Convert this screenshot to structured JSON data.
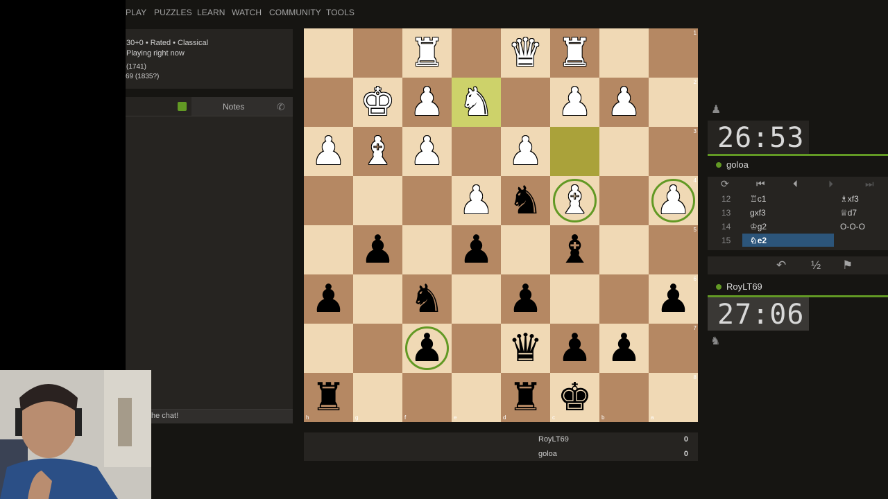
{
  "nav": {
    "items": [
      "PLAY",
      "PUZZLES",
      "LEARN",
      "WATCH",
      "COMMUNITY",
      "TOOLS"
    ]
  },
  "game_info": {
    "mode": "30+0 • Rated • Classical",
    "status": "Playing right now",
    "white_rating": "(1741)",
    "black_partial": "69 (1835?)"
  },
  "chat": {
    "tab_notes": "Notes",
    "input_placeholder": "he chat!"
  },
  "board": {
    "orientation": "black",
    "ranks_label": [
      "1",
      "2",
      "3",
      "4",
      "5",
      "6",
      "7",
      "8"
    ],
    "files_label": [
      "h",
      "g",
      "f",
      "e",
      "d",
      "c",
      "b",
      "a"
    ],
    "pieces": [
      {
        "sq": "f1",
        "p": "♜",
        "c": "w"
      },
      {
        "sq": "d1",
        "p": "♛",
        "c": "w"
      },
      {
        "sq": "c1",
        "p": "♜",
        "c": "w"
      },
      {
        "sq": "g2",
        "p": "♚",
        "c": "w"
      },
      {
        "sq": "f2",
        "p": "♟",
        "c": "w"
      },
      {
        "sq": "e2",
        "p": "♞",
        "c": "w"
      },
      {
        "sq": "c2",
        "p": "♟",
        "c": "w"
      },
      {
        "sq": "b2",
        "p": "♟",
        "c": "w"
      },
      {
        "sq": "h3",
        "p": "♟",
        "c": "w"
      },
      {
        "sq": "g3",
        "p": "♝",
        "c": "w"
      },
      {
        "sq": "f3",
        "p": "♟",
        "c": "w"
      },
      {
        "sq": "d3",
        "p": "♟",
        "c": "w"
      },
      {
        "sq": "e4",
        "p": "♟",
        "c": "w"
      },
      {
        "sq": "c4",
        "p": "♝",
        "c": "w"
      },
      {
        "sq": "a4",
        "p": "♟",
        "c": "w"
      },
      {
        "sq": "d4",
        "p": "♞",
        "c": "b"
      },
      {
        "sq": "g5",
        "p": "♟",
        "c": "b"
      },
      {
        "sq": "e5",
        "p": "♟",
        "c": "b"
      },
      {
        "sq": "c5",
        "p": "♝",
        "c": "b"
      },
      {
        "sq": "h6",
        "p": "♟",
        "c": "b"
      },
      {
        "sq": "f6",
        "p": "♞",
        "c": "b"
      },
      {
        "sq": "d6",
        "p": "♟",
        "c": "b"
      },
      {
        "sq": "a6",
        "p": "♟",
        "c": "b"
      },
      {
        "sq": "f7",
        "p": "♟",
        "c": "b"
      },
      {
        "sq": "d7",
        "p": "♛",
        "c": "b"
      },
      {
        "sq": "c7",
        "p": "♟",
        "c": "b"
      },
      {
        "sq": "b7",
        "p": "♟",
        "c": "b"
      },
      {
        "sq": "h8",
        "p": "♜",
        "c": "b"
      },
      {
        "sq": "d8",
        "p": "♜",
        "c": "b"
      },
      {
        "sq": "c8",
        "p": "♚",
        "c": "b"
      }
    ],
    "last_move": [
      "e2",
      "c3"
    ],
    "rings": [
      "c4",
      "a4",
      "f7"
    ]
  },
  "result_panel": {
    "rows": [
      {
        "name": "RoyLT69",
        "score": "0"
      },
      {
        "name": "goloa",
        "score": "0"
      }
    ]
  },
  "clocks": {
    "top": {
      "time": "26:53",
      "player": "goloa"
    },
    "bottom": {
      "time": "27:06",
      "player": "RoyLT69"
    }
  },
  "moves": [
    {
      "num": "12",
      "w": "♖c1",
      "b": "♗xf3"
    },
    {
      "num": "13",
      "w": "gxf3",
      "b": "♕d7"
    },
    {
      "num": "14",
      "w": "♔g2",
      "b": "O-O-O"
    },
    {
      "num": "15",
      "w": "♘e2",
      "b": ""
    }
  ],
  "actions": {
    "takeback": "↶",
    "draw": "½",
    "resign": "⚑"
  },
  "colors": {
    "light": "#f0d9b5",
    "dark": "#b58863",
    "accent": "#629924"
  }
}
